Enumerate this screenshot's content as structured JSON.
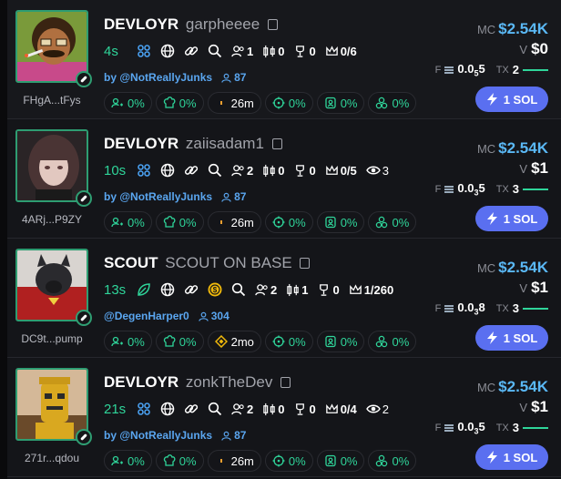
{
  "colors": {
    "accent_green": "#2fd59a",
    "accent_blue": "#5ab8f5",
    "button_purple": "#5a6ff0",
    "link_blue": "#5aa6f0"
  },
  "tokens": [
    {
      "symbol": "DEVLOYR",
      "name": "garpheeee",
      "address": "FHgA...tFys",
      "age": "4s",
      "dev_stats": {
        "holders": "1",
        "dev_buys": "0",
        "trophy": "0",
        "crown": "0/6"
      },
      "creator": "by @NotReallyJunks",
      "creator_holders": "87",
      "chips": {
        "top10": "0%",
        "chef": "0%",
        "time": "26m",
        "sniper": "0%",
        "insider": "0%",
        "bundle": "0%"
      },
      "mc_label": "MC",
      "mc": "$2.54K",
      "v_label": "V",
      "v": "$0",
      "f_label": "F",
      "f_main": "0.0",
      "f_sub": "5",
      "f_tail": "5",
      "tx_label": "TX",
      "tx": "2",
      "buy_label": "1 SOL"
    },
    {
      "symbol": "DEVLOYR",
      "name": "zaiisadam1",
      "address": "4ARj...P9ZY",
      "age": "10s",
      "dev_stats": {
        "holders": "2",
        "dev_buys": "0",
        "trophy": "0",
        "crown": "0/5",
        "views": "3"
      },
      "creator": "by @NotReallyJunks",
      "creator_holders": "87",
      "chips": {
        "top10": "0%",
        "chef": "0%",
        "time": "26m",
        "sniper": "0%",
        "insider": "0%",
        "bundle": "0%"
      },
      "mc_label": "MC",
      "mc": "$2.54K",
      "v_label": "V",
      "v": "$1",
      "f_label": "F",
      "f_main": "0.0",
      "f_sub": "3",
      "f_tail": "5",
      "tx_label": "TX",
      "tx": "3",
      "buy_label": "1 SOL"
    },
    {
      "symbol": "SCOUT",
      "name": "SCOUT ON BASE",
      "address": "DC9t...pump",
      "age": "13s",
      "dev_stats": {
        "holders": "2",
        "dev_buys": "1",
        "trophy": "0",
        "crown": "1/260"
      },
      "creator": "@DegenHarper0",
      "creator_holders": "304",
      "chips": {
        "top10": "0%",
        "chef": "0%",
        "time": "2mo",
        "sniper": "0%",
        "insider": "0%",
        "bundle": "0%"
      },
      "mc_label": "MC",
      "mc": "$2.54K",
      "v_label": "V",
      "v": "$1",
      "f_label": "F",
      "f_main": "0.0",
      "f_sub": "3",
      "f_tail": "8",
      "tx_label": "TX",
      "tx": "3",
      "buy_label": "1 SOL"
    },
    {
      "symbol": "DEVLOYR",
      "name": "zonkTheDev",
      "address": "271r...qdou",
      "age": "21s",
      "dev_stats": {
        "holders": "2",
        "dev_buys": "0",
        "trophy": "0",
        "crown": "0/4",
        "views": "2"
      },
      "creator": "by @NotReallyJunks",
      "creator_holders": "87",
      "chips": {
        "top10": "0%",
        "chef": "0%",
        "time": "26m",
        "sniper": "0%",
        "insider": "0%",
        "bundle": "0%"
      },
      "mc_label": "MC",
      "mc": "$2.54K",
      "v_label": "V",
      "v": "$1",
      "f_label": "F",
      "f_main": "0.0",
      "f_sub": "3",
      "f_tail": "5",
      "tx_label": "TX",
      "tx": "3",
      "buy_label": "1 SOL"
    }
  ]
}
